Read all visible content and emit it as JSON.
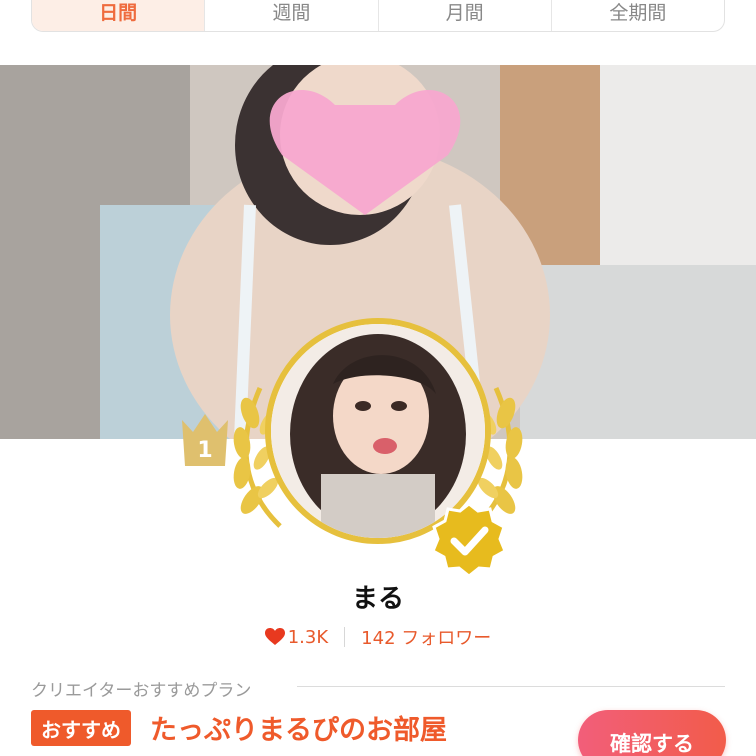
{
  "tabs": [
    {
      "label": "日間",
      "active": true
    },
    {
      "label": "週間",
      "active": false
    },
    {
      "label": "月間",
      "active": false
    },
    {
      "label": "全期間",
      "active": false
    }
  ],
  "rank": {
    "number": "1"
  },
  "creator": {
    "name": "まる"
  },
  "stats": {
    "likes": "1.3K",
    "followers": "142 フォロワー"
  },
  "plan_section": {
    "heading": "クリエイターおすすめプラン",
    "badge": "おすすめ",
    "title": "たっぷりまるぴのお部屋",
    "button": "確認する"
  },
  "colors": {
    "accent": "#ef5a2b",
    "gold": "#e6c03d",
    "button": "#f25e6a"
  },
  "icons": [
    "crown-icon",
    "laurel-icon",
    "verified-badge-icon",
    "heart-icon"
  ]
}
